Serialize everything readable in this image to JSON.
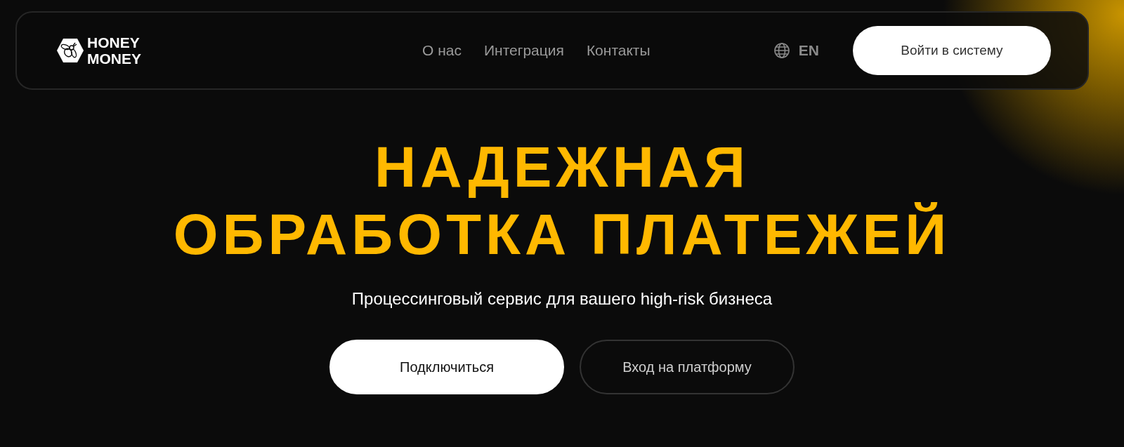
{
  "logo": {
    "lines": [
      "HONEY",
      "MONEY"
    ]
  },
  "nav": [
    {
      "label": "О нас"
    },
    {
      "label": "Интеграция"
    },
    {
      "label": "Контакты"
    }
  ],
  "language": {
    "label": "EN"
  },
  "login_button": {
    "label": "Войти в систему"
  },
  "hero": {
    "title_lines": [
      "НАДЕЖНАЯ",
      "ОБРАБОТКА ПЛАТЕЖЕЙ"
    ],
    "subtitle": "Процессинговый сервис для вашего high-risk бизнеса"
  },
  "actions": [
    {
      "label": "Подключиться",
      "kind": "primary"
    },
    {
      "label": "Вход на платформу",
      "kind": "outline"
    }
  ]
}
